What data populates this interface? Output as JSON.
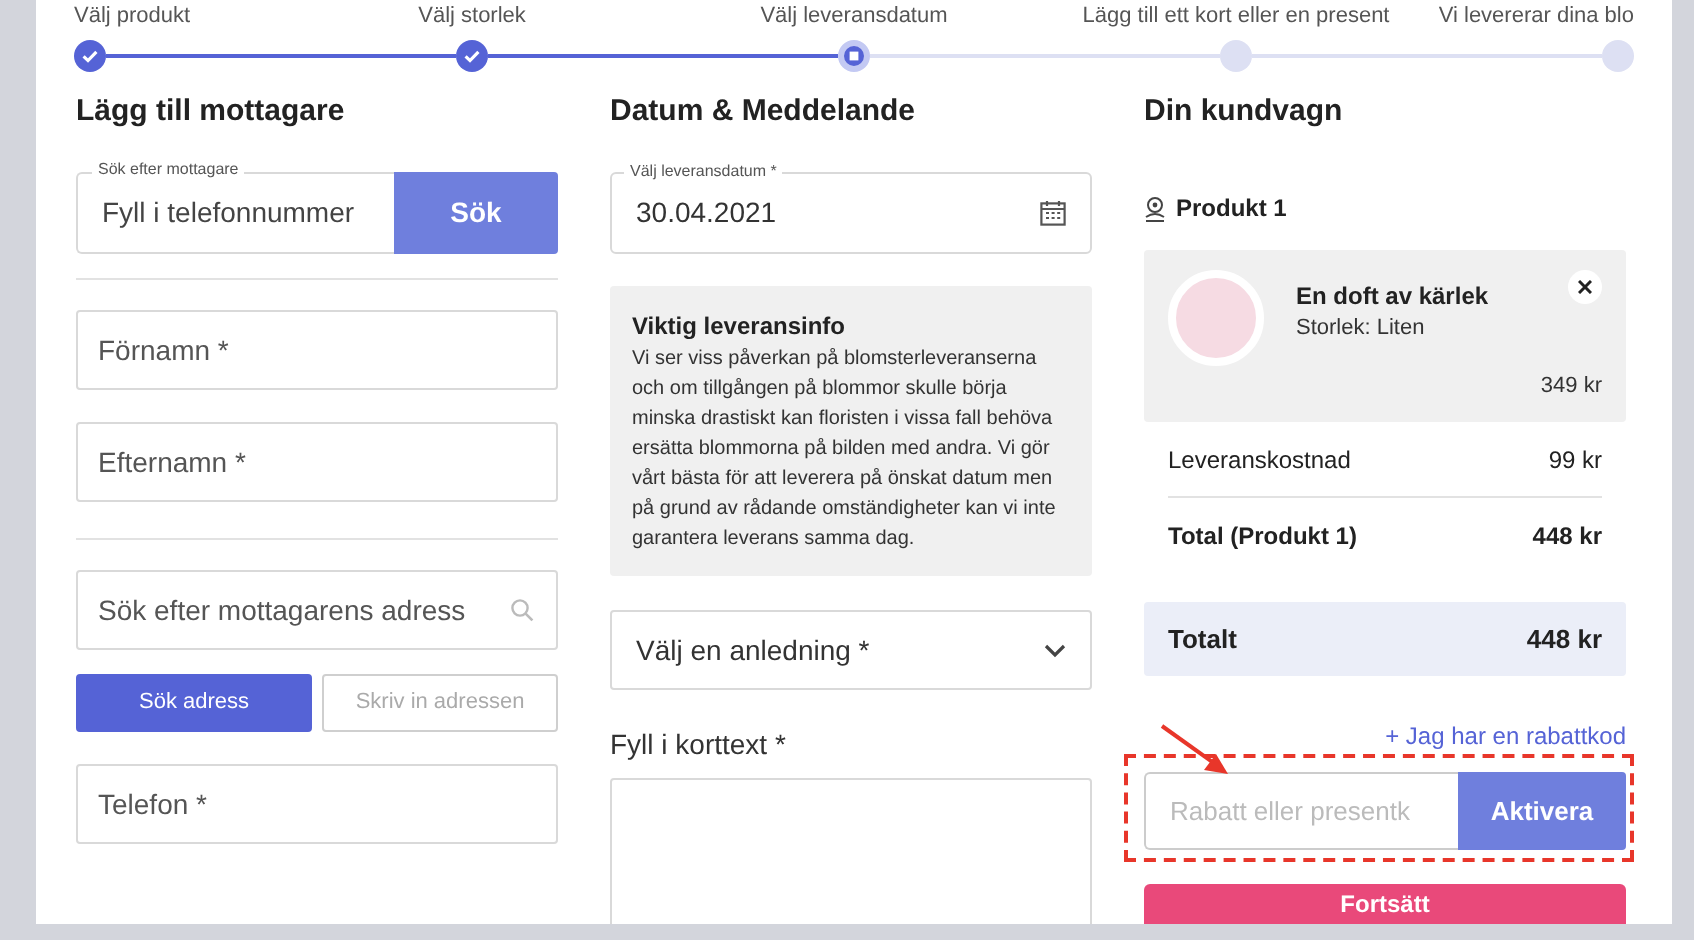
{
  "stepper": [
    {
      "label": "Välj produkt",
      "done": true,
      "current": false
    },
    {
      "label": "Välj storlek",
      "done": true,
      "current": false
    },
    {
      "label": "Välj leveransdatum",
      "done": false,
      "current": true
    },
    {
      "label": "Lägg till ett kort eller en present",
      "done": false,
      "current": false
    },
    {
      "label": "Vi levererar dina blo",
      "done": false,
      "current": false
    }
  ],
  "recipient": {
    "title": "Lägg till mottagare",
    "phone_search": {
      "label": "Sök efter mottagare",
      "placeholder": "Fyll i telefonnummer",
      "button": "Sök"
    },
    "first_name": {
      "placeholder": "Förnamn *"
    },
    "last_name": {
      "placeholder": "Efternamn *"
    },
    "address": {
      "placeholder": "Sök efter mottagarens adress"
    },
    "address_modes": [
      {
        "label": "Sök adress",
        "selected": true
      },
      {
        "label": "Skriv in adressen",
        "selected": false
      }
    ],
    "phone": {
      "placeholder": "Telefon *"
    }
  },
  "message": {
    "title": "Datum & Meddelande",
    "date": {
      "label": "Välj leveransdatum *",
      "value": "30.04.2021"
    },
    "info": {
      "title": "Viktig leveransinfo",
      "text": "Vi ser viss påverkan på blomsterleveranserna och om tillgången på blommor skulle börja minska drastiskt kan floristen i vissa fall behöva ersätta blommorna på bilden med andra. Vi gör vårt bästa för att leverera på önskat datum men på grund av rådande omständigheter kan vi inte garantera leverans samma dag."
    },
    "reason": {
      "placeholder": "Välj en anledning *"
    },
    "card_text": {
      "label": "Fyll i korttext *"
    }
  },
  "cart": {
    "title": "Din kundvagn",
    "product_heading": "Produkt 1",
    "item": {
      "name": "En doft av kärlek",
      "size": "Storlek: Liten",
      "price": "349 kr"
    },
    "lines": [
      {
        "label": "Leveranskostnad",
        "amount": "99 kr",
        "kind": "normal"
      },
      {
        "label": "Total (Produkt 1)",
        "amount": "448 kr",
        "kind": "subtotal"
      }
    ],
    "total": {
      "label": "Totalt",
      "amount": "448 kr"
    },
    "discount_link": "+ Jag har en rabattkod",
    "discount": {
      "placeholder": "Rabatt eller presentk",
      "button": "Aktivera"
    },
    "continue_button": "Fortsätt"
  },
  "annotation": {
    "highlight_box": true,
    "arrow": true
  }
}
